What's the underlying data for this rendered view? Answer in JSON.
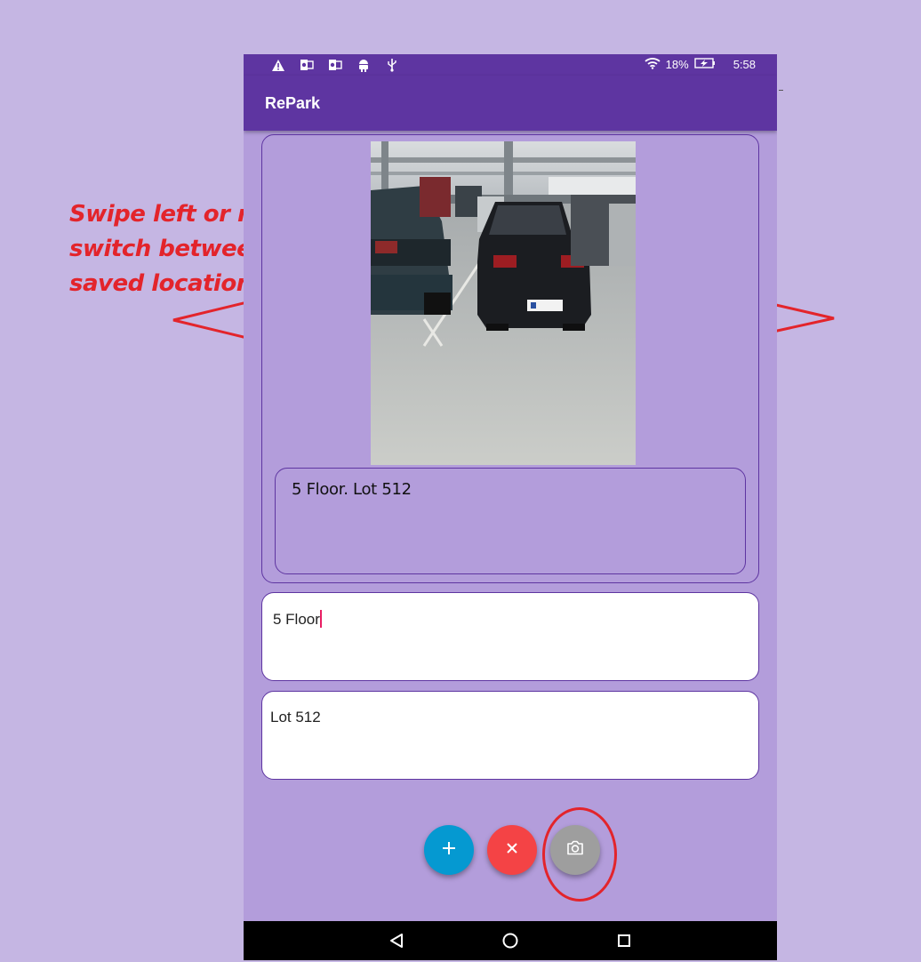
{
  "status_bar": {
    "battery": "18%",
    "time": "5:58",
    "left_icons": [
      "warning-icon",
      "outlook-icon",
      "outlook-icon",
      "android-icon",
      "usb-icon"
    ]
  },
  "app_bar": {
    "title": "RePark"
  },
  "location_card": {
    "photo": "parking-garage-photo",
    "note": "5 Floor.  Lot 512"
  },
  "floor_field": {
    "value": "5 Floor"
  },
  "lot_field": {
    "value": "Lot 512"
  },
  "fabs": {
    "add": {
      "icon": "plus-icon",
      "color": "#0599d1"
    },
    "delete": {
      "icon": "close-icon",
      "color": "#f44345"
    },
    "camera": {
      "icon": "camera-icon",
      "color": "#9e9e9e"
    }
  },
  "annotation": {
    "text": "Swipe left or right to switch between your saved locations!",
    "color": "#e3242b"
  },
  "colors": {
    "primary": "#5e35a1",
    "background": "#b39ddb",
    "outer": "#c5b6e3"
  }
}
